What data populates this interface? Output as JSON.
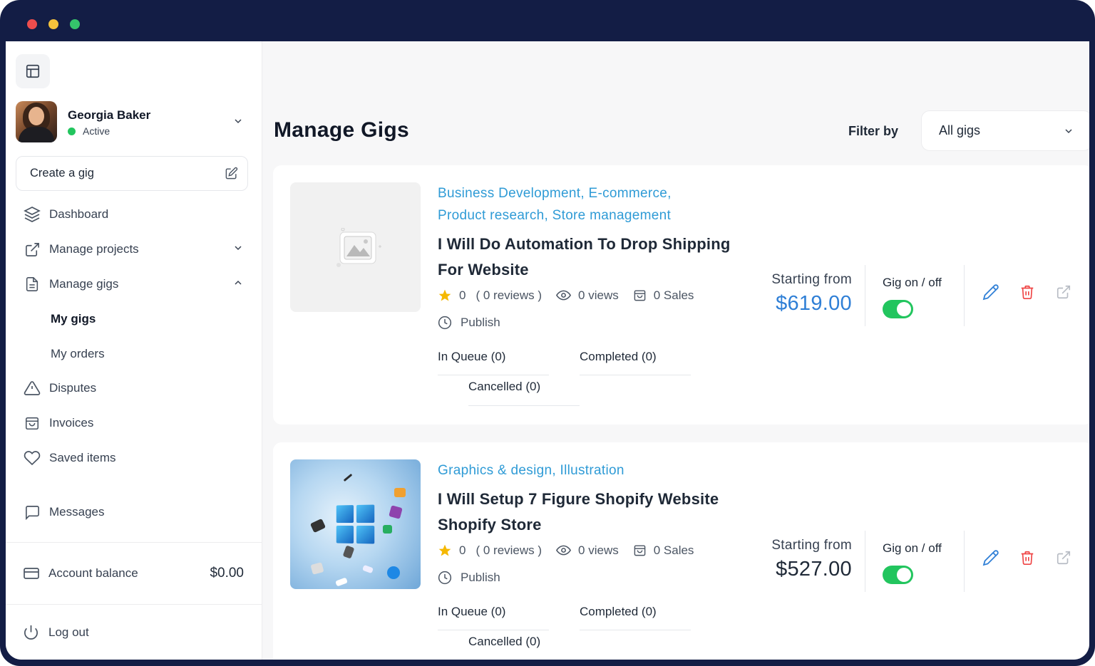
{
  "user": {
    "name": "Georgia Baker",
    "status": "Active"
  },
  "sidebar": {
    "create_gig": "Create a gig",
    "items": {
      "dashboard": "Dashboard",
      "manage_projects": "Manage projects",
      "manage_gigs": "Manage gigs",
      "my_gigs": "My gigs",
      "my_orders": "My orders",
      "disputes": "Disputes",
      "invoices": "Invoices",
      "saved_items": "Saved items",
      "messages": "Messages"
    },
    "account_balance_label": "Account balance",
    "account_balance_value": "$0.00",
    "logout": "Log out"
  },
  "main": {
    "title": "Manage Gigs",
    "filter_label": "Filter by",
    "filter_value": "All gigs"
  },
  "gigs": [
    {
      "categories_line1": "Business Development, E-commerce,",
      "categories_line2": "Product research, Store management",
      "title_line1": "I Will Do Automation To Drop Shipping",
      "title_line2": "For Website",
      "rating": "0",
      "reviews": "( 0 reviews )",
      "views": "0 views",
      "sales": "0 Sales",
      "status": "Publish",
      "in_queue": "In Queue (0)",
      "completed": "Completed (0)",
      "cancelled": "Cancelled (0)",
      "starting_from": "Starting from",
      "price": "$619.00",
      "toggle_label": "Gig on / off",
      "toggle_on": true
    },
    {
      "categories_line1": "Graphics & design, Illustration",
      "categories_line2": "",
      "title_line1": "I Will Setup 7 Figure Shopify Website",
      "title_line2": "Shopify Store",
      "rating": "0",
      "reviews": "( 0 reviews )",
      "views": "0 views",
      "sales": "0 Sales",
      "status": "Publish",
      "in_queue": "In Queue (0)",
      "completed": "Completed (0)",
      "cancelled": "Cancelled (0)",
      "starting_from": "Starting from",
      "price": "$527.00",
      "toggle_label": "Gig on / off",
      "toggle_on": true
    }
  ],
  "colors": {
    "frame": "#131d45",
    "accent_blue": "#2f7fd6",
    "category_blue": "#2f9bd6",
    "toggle_green": "#22c55e",
    "delete_red": "#ef4444"
  },
  "icons": {
    "layout": "layout-icon",
    "create": "edit-square-icon",
    "dashboard": "layers-icon",
    "projects": "external-link-icon",
    "gigs": "document-icon",
    "disputes": "warning-icon",
    "invoices": "bag-icon",
    "saved": "heart-icon",
    "messages": "chat-icon",
    "balance": "credit-card-icon",
    "logout": "power-icon"
  }
}
